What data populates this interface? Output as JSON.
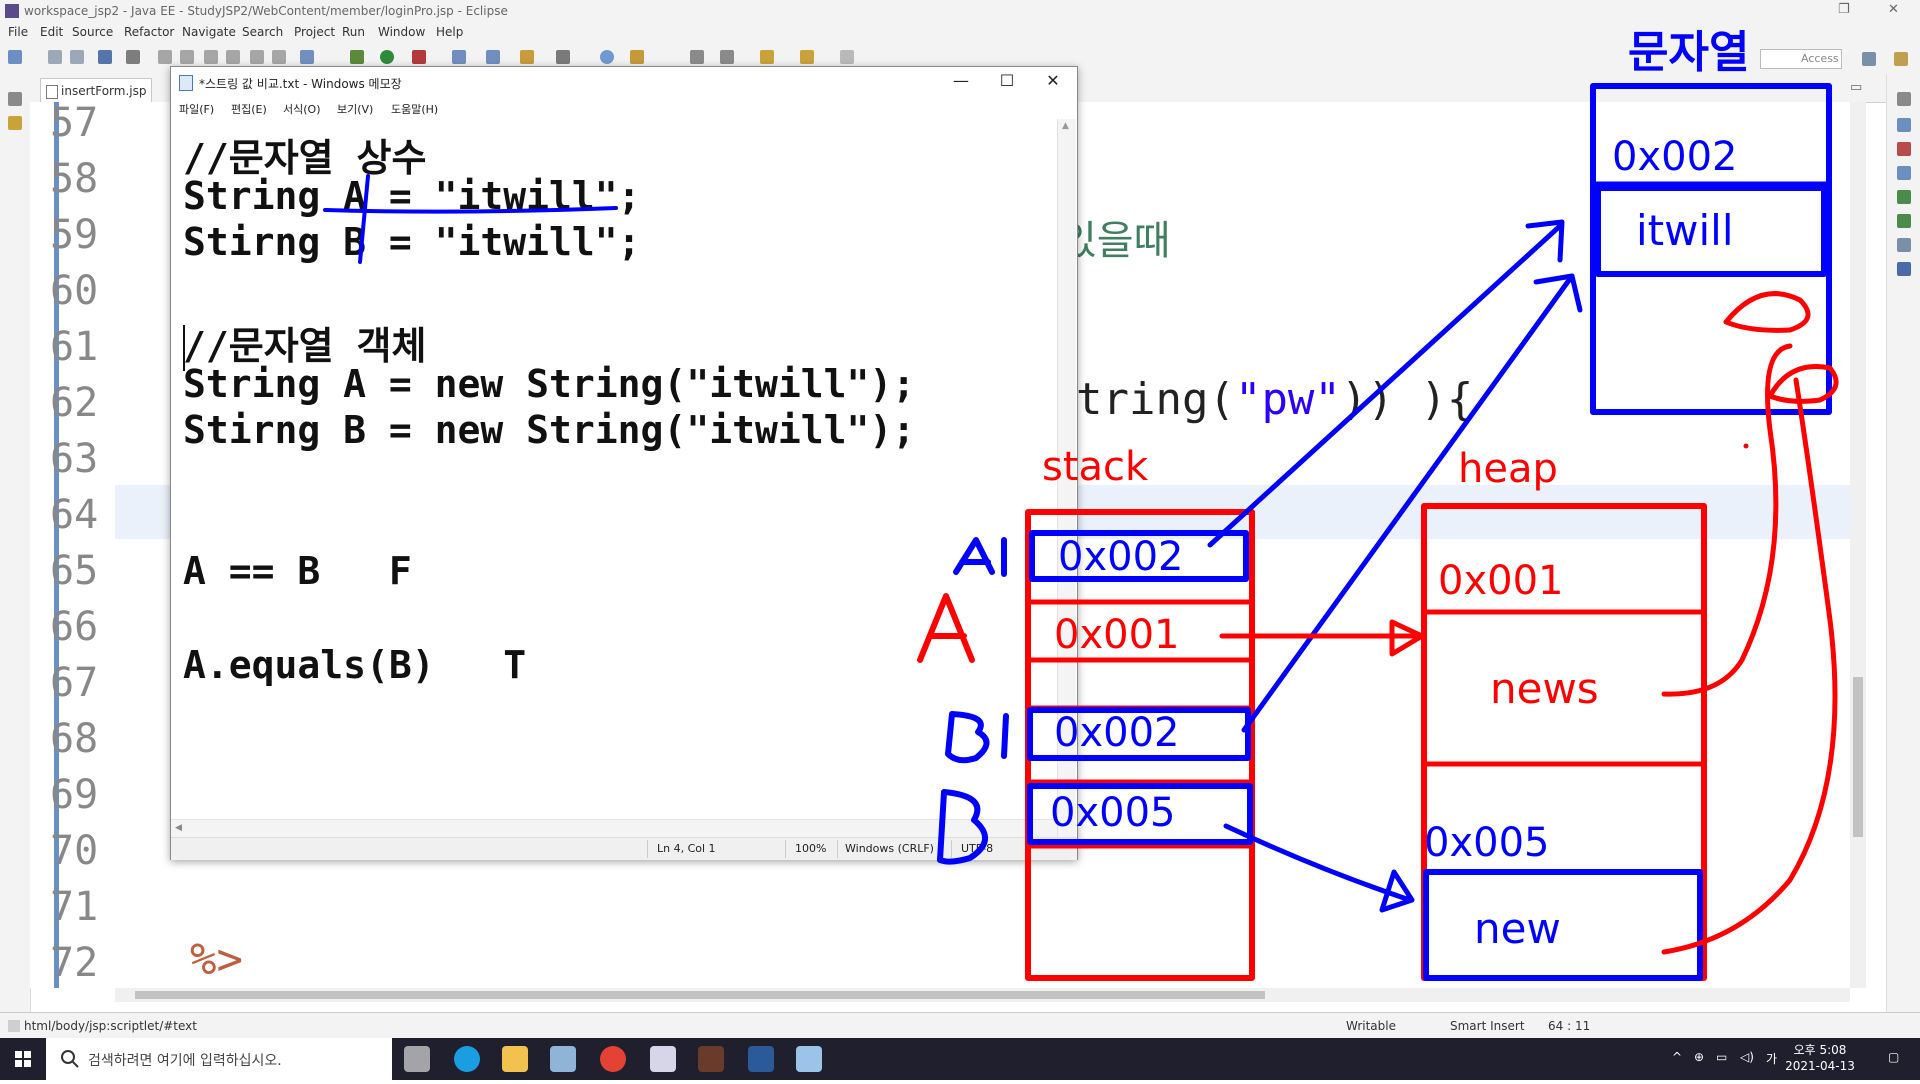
{
  "window": {
    "title": "workspace_jsp2 - Java EE - StudyJSP2/WebContent/member/loginPro.jsp - Eclipse"
  },
  "menubar": [
    "File",
    "Edit",
    "Source",
    "Refactor",
    "Navigate",
    "Search",
    "Project",
    "Run",
    "Window",
    "Help"
  ],
  "toolbar": {
    "quick_access": "Access"
  },
  "editor": {
    "tab_label": "insertForm.jsp",
    "line_numbers": [
      "57",
      "58",
      "59",
      "60",
      "61",
      "62",
      "63",
      "64",
      "65",
      "66",
      "67",
      "68",
      "69",
      "70",
      "71",
      "72"
    ],
    "visible_code": {
      "line59_fragment": "있을때",
      "line62_fragment_a": "tring(",
      "line62_fragment_b": "\"pw\"",
      "line62_fragment_c": ")) ){",
      "line72": "%>"
    }
  },
  "notepad": {
    "title": "*스트링 값 비교.txt - Windows 메모장",
    "menu": [
      "파일(F)",
      "편집(E)",
      "서식(O)",
      "보기(V)",
      "도움말(H)"
    ],
    "lines": [
      "//문자열 상수",
      "String A = \"itwill\";",
      "Stirng B = \"itwill\";",
      "",
      "//문자열 객체",
      "String A = new String(\"itwill\");",
      "Stirng B = new String(\"itwill\");",
      "",
      "",
      "A == B   F",
      "",
      "A.equals(B)   T"
    ],
    "status": {
      "position": "Ln 4, Col 1",
      "zoom": "100%",
      "line_ending": "Windows (CRLF)",
      "encoding": "UTF-8"
    }
  },
  "annotations": {
    "pool_title": "문자열",
    "stack_label": "stack",
    "heap_label": "heap",
    "stack_cells": [
      "0x002",
      "0x001",
      "0x002",
      "0x005"
    ],
    "stack_names": [
      "A1",
      "A",
      "B1",
      "B"
    ],
    "heap_addr_1": "0x001",
    "heap_value_1": "news",
    "heap_addr_2": "0x005",
    "heap_value_2": "new",
    "pool_addr": "0x002",
    "pool_value": "itwill",
    "colors": {
      "red": "#ff0000",
      "blue": "#0000ff"
    }
  },
  "statusbar": {
    "path": "html/body/jsp:scriptlet/#text",
    "mode": "Writable",
    "insert": "Smart Insert",
    "position": "64 : 11"
  },
  "taskbar": {
    "search_placeholder": "검색하려면 여기에 입력하십시오.",
    "time_period": "오후 5:08",
    "date": "2021-04-13",
    "ime": "가"
  }
}
